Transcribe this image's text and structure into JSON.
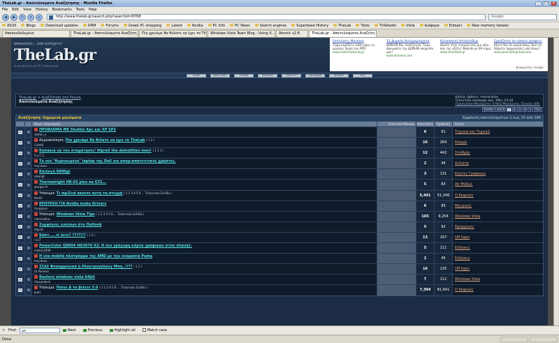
{
  "window": {
    "title": "TheLab.gr - Αποτελέσματα Αναζήτησης - Mozilla Firefox"
  },
  "menu": [
    "File",
    "Edit",
    "View",
    "History",
    "Bookmarks",
    "Tools",
    "Help"
  ],
  "nav": {
    "url": "http://www.thelab.gr/search.php?searchid=8768",
    "search_placeholder": "Google"
  },
  "bookmarks": [
    "ASUS",
    "Blogs",
    "Download updates",
    "DRM",
    "Forums",
    "Greek PC shopping",
    "Latest",
    "Nvidia",
    "PC Info",
    "PC News",
    "Search engines",
    "Superbase History",
    "TheLab",
    "Tools",
    "TV&Radio",
    "Vista",
    "Διάφορα",
    "Ειπορεί",
    "New memory tweaks"
  ],
  "tabs": [
    {
      "label": "Αποσυνδεδεμένο",
      "size": "normal"
    },
    {
      "label": "TheLab.gr - Αποτελέσματα Αναζήτη...",
      "size": "normal"
    },
    {
      "label": "Πιο χρειάμε θα θέλατε να έχει το Th...",
      "size": "normal"
    },
    {
      "label": "Windows Vista Team Blog : Using V...",
      "size": "normal"
    },
    {
      "label": "Atomic v2.8",
      "size": "small"
    },
    {
      "label": "TheLab.gr - Αποτελέσματα Αναζήτη...",
      "size": "normal",
      "active": true
    }
  ],
  "header": {
    "tagline": "απογεύστε... όσο αντέχετε!",
    "logo": "TheLab.gr",
    "logo_sub": "Η κοινότητα για PC enthusiasts"
  },
  "ads": [
    {
      "title": "Εκπτώσεις Μουσικά",
      "text": "Τώρα κερδίζεις κάθε μέρα τις μεγάλες δώρα του PPD!",
      "url": "www.multimediacity.gr"
    },
    {
      "title": "31 Δωρεάν Καλημερίσματα",
      "text": "ΔΩΡΕΑΝ Βίο. Αναζήτηση, Τώρα Δοκιμάστε την ΔΩΡΕΑΝ υπηρεσία μας!",
      "url": "www.dominet.com"
    },
    {
      "title": "Κατασκευή Ιστοσελίδων",
      "text": "Δωστε στην εταιρεία σας μια αξία που της αξίζει! Website με 99 ευρώ.",
      "url": "www.smartweb.gr"
    },
    {
      "title": "Εργάζεστε σε κάποια γραφείο;",
      "text": "Κάντε Και σε εργοστάσια; Εκεί να δέχεστε παραγγελίες από όλους!",
      "url": "www.joven328.gr/business"
    }
  ],
  "ads_label": "Διαφημίσεις Google",
  "navbuttons": [
    "HOME",
    "BUDCLINIC",
    "FORUM",
    "REVIEWS",
    "USER CP",
    "CALENDAR",
    "SEARCH",
    "FAQ"
  ],
  "breadcrumb": {
    "root": "TheLab.gr",
    "forum": "Αναζήτηση στο Forum",
    "current": "Αποτελέσματα Αναζήτησης",
    "welcome": "Καλώς ήρθατε, monocalios.",
    "last_visit": "Τελευταία επίσκεψη σας: Χθες 23:34",
    "private_msgs": "Προσωπικά Μηνύματα: 0 Νέα Μηνύματα, Σύνολο 109."
  },
  "pager": {
    "label": "Σελίδα 1 από 8",
    "pages": [
      "1",
      "2",
      "3",
      "4",
      ">",
      "Τελ."
    ]
  },
  "results": {
    "title": "Αναζήτηση: Σημερινά μηνύματα",
    "hint": "Εμφάνιση αποτελεσμάτων 1 έως 25 από 184",
    "columns": {
      "title": "Θέμα / Δημιουργός",
      "last": "Τελευταίο Μήνυμα",
      "replies": "Απαντήσεις",
      "views": "Προβολές",
      "forum": "Forum"
    }
  },
  "rows": [
    {
      "prefix": "",
      "title": "ΠΡΟΒΛΗΜΑ ΜΕ Shuttle Xpc και XP SP2",
      "pages": "",
      "author": "dalton_n",
      "replies": "6",
      "views": "61",
      "forum": "Τεχνικά και Τεχνική"
    },
    {
      "prefix": "Δημοσκόπηση: ",
      "title": "Πιο χρειάμε θα θέλατε να έχει το TheLab",
      "pages": "( 1 2 )",
      "author": "Cube8",
      "replies": "16",
      "views": "264",
      "forum": "Κόσμοι"
    },
    {
      "prefix": "",
      "title": "Καπακια να τον σταματησει! Hipre5 the demolition men!",
      "pages": "( 1 2 3 )",
      "author": "S.L.C.C.",
      "replies": "12",
      "views": "442",
      "forum": "Σταθμός"
    },
    {
      "prefix": "",
      "title": "Το νέο \"θυρεοειμένο\" laptop της Dell για απορ-απατιτιτικός χρήστες.",
      "pages": "",
      "author": "heyvtoos",
      "replies": "2",
      "views": "44",
      "forum": "Σελιστρ"
    },
    {
      "prefix": "",
      "title": "Επιλογή 8800gt",
      "pages": "",
      "author": "alkengt",
      "replies": "3",
      "views": "131",
      "forum": "Κάρτες Γραφικών"
    },
    {
      "prefix": "",
      "title": "Thermalright HR-03 plus ea GT2...",
      "pages": "",
      "author": "giorgos fs",
      "replies": "5",
      "views": "83",
      "forum": "Air Ψύξεις"
    },
    {
      "prefix": "Υπόκυμα: ",
      "title": "Τι mp3/cd ακούτε αυτή τη στιγμή",
      "pages": "( 1 2 3 4 5 6 ... Τελευταία Σελίδα )",
      "author": "KostX",
      "replies": "5,441",
      "views": "51,246",
      "forum": "Ο Καφενές"
    },
    {
      "prefix": "",
      "title": "ΕΡΩΤΗΣΗ ΓΙΑ Nvidia mobo Drivers",
      "pages": "",
      "author": "Fangaxas",
      "replies": "6",
      "views": "85",
      "forum": "Μητρικές"
    },
    {
      "prefix": "Υπόκυμα: ",
      "title": "Windows Vista Tips",
      "pages": "( 1 2 3 4 5 6 ... Τελευταία Σελίδα )",
      "author": "marinsellas",
      "replies": "165",
      "views": "9,254",
      "forum": "Windows Vista"
    },
    {
      "prefix": "",
      "title": "Συμφύγιες εικόνων στο Outlook",
      "pages": "",
      "author": "kfgorp",
      "replies": "5",
      "views": "92",
      "forum": "Εφαρμογές"
    },
    {
      "prefix": "",
      "title": "Κάπτ.....τί λέτε? ?????/?",
      "pages": "( 1 2 )",
      "author": "r117",
      "replies": "13",
      "views": "167",
      "forum": "Off topic"
    },
    {
      "prefix": "",
      "title": "PowerColor Q8804 HD3870 X2: Η πιο γρήγορη κάρτα γραφικών στον πλανήτ.",
      "pages": "",
      "author": "makris2444",
      "replies": "5",
      "views": "111",
      "forum": "Ειδήσεις"
    },
    {
      "prefix": "",
      "title": "Η νέα mobile πλατφόρμα της AMD με την ονομασία Puma",
      "pages": "",
      "author": "heyvtoos",
      "replies": "2",
      "views": "45",
      "forum": "Ειδήσεις"
    },
    {
      "prefix": "",
      "title": "ΣΣΑΣ Φυσαρμονικά ή Ηλεκτρογάλανγ Μπη..!!??",
      "pages": "( 1 2 )",
      "author": "Dr.Parness",
      "replies": "16",
      "views": "135",
      "forum": "Off topic"
    },
    {
      "prefix": "",
      "title": "Restore windows vista 64bit",
      "pages": "",
      "author": "Alexander4",
      "replies": "7",
      "views": "112",
      "forum": "Windows Vista"
    },
    {
      "prefix": "Υπόκυμα: ",
      "title": "Πιάνε Δ το βιλέτε 3.0",
      "pages": "( 1 2 3 4 5 6 ... Τελευταία Σελίδα )",
      "author": "Jedix",
      "replies": "7,394",
      "views": "81,641",
      "forum": "Ο Καφενές"
    }
  ],
  "findbar": {
    "label": "Find:",
    "value": "set",
    "next": "Next",
    "previous": "Previous",
    "highlight": "Highlight all",
    "matchcase": "Match case"
  },
  "status": {
    "text": "Done"
  }
}
